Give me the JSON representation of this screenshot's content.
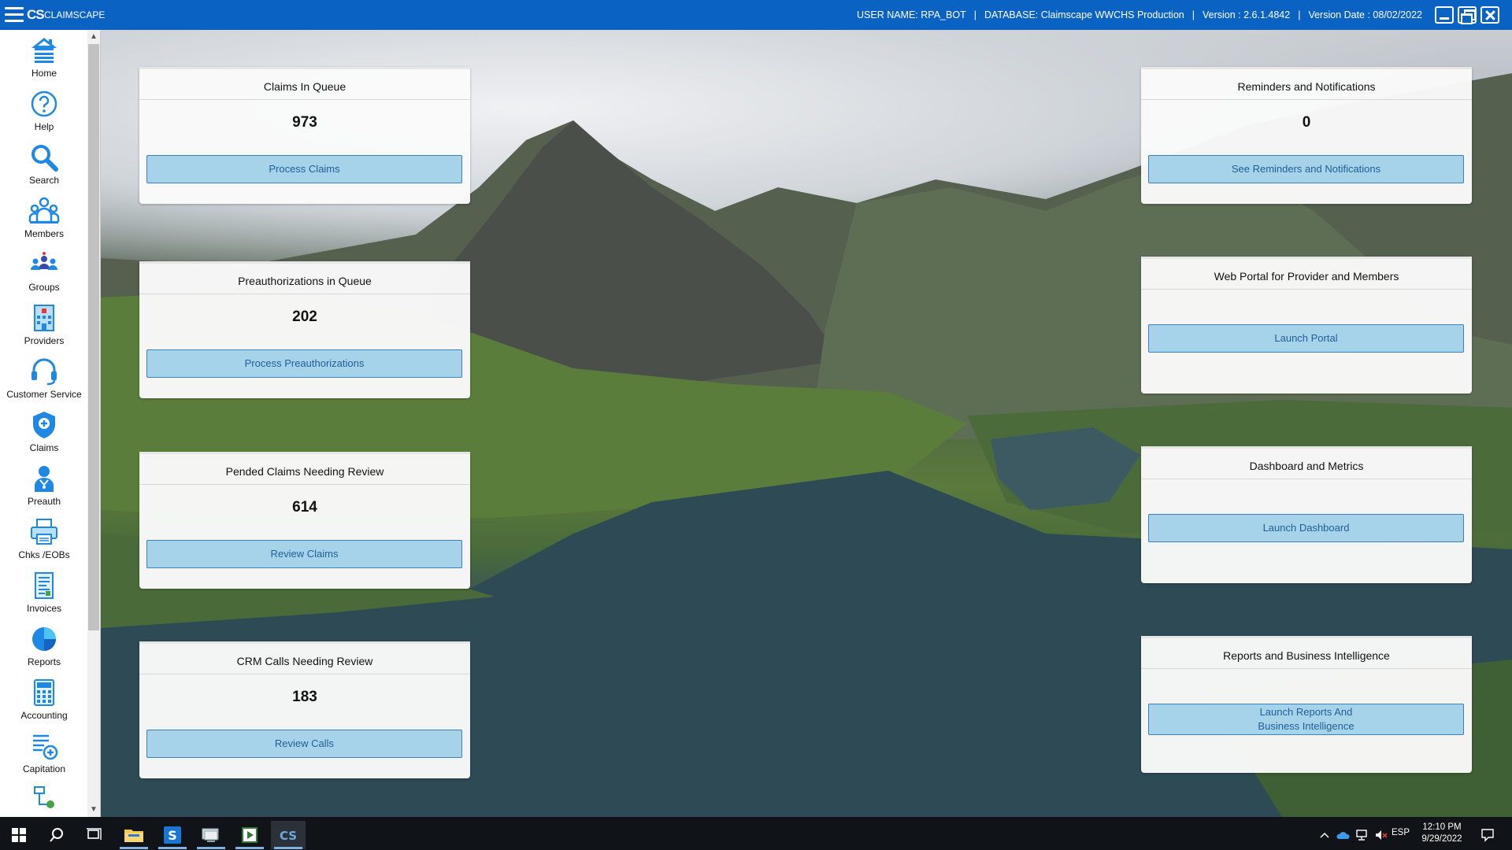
{
  "titlebar": {
    "app_name": "CLAIMSCAPE",
    "logo_text": "CS",
    "user": "USER NAME: RPA_BOT",
    "database": "DATABASE: Claimscape WWCHS Production",
    "version": "Version : 2.6.1.4842",
    "version_date": "Version Date : 08/02/2022",
    "separator": "|"
  },
  "sidebar": {
    "items": [
      {
        "label": "Home",
        "icon": "home-icon"
      },
      {
        "label": "Help",
        "icon": "help-icon"
      },
      {
        "label": "Search",
        "icon": "search-icon"
      },
      {
        "label": "Members",
        "icon": "members-icon"
      },
      {
        "label": "Groups",
        "icon": "groups-icon"
      },
      {
        "label": "Providers",
        "icon": "providers-icon"
      },
      {
        "label": "Customer Service",
        "icon": "headset-icon"
      },
      {
        "label": "Claims",
        "icon": "shield-plus-icon"
      },
      {
        "label": "Preauth",
        "icon": "doctor-icon"
      },
      {
        "label": "Chks /EOBs",
        "icon": "printer-icon"
      },
      {
        "label": "Invoices",
        "icon": "invoice-icon"
      },
      {
        "label": "Reports",
        "icon": "pie-chart-icon"
      },
      {
        "label": "Accounting",
        "icon": "calculator-icon"
      },
      {
        "label": "Capitation",
        "icon": "list-add-icon"
      }
    ]
  },
  "cards_left": [
    {
      "title": "Claims In Queue",
      "value": "973",
      "button": "Process Claims"
    },
    {
      "title": "Preauthorizations in Queue",
      "value": "202",
      "button": "Process Preauthorizations"
    },
    {
      "title": "Pended Claims Needing Review",
      "value": "614",
      "button": "Review Claims"
    },
    {
      "title": "CRM Calls Needing Review",
      "value": "183",
      "button": "Review Calls"
    }
  ],
  "cards_right": [
    {
      "title": "Reminders and Notifications",
      "value": "0",
      "button": "See Reminders and Notifications"
    },
    {
      "title": "Web Portal for Provider and Members",
      "value": "",
      "button": "Launch Portal"
    },
    {
      "title": "Dashboard and Metrics",
      "value": "",
      "button": "Launch Dashboard"
    },
    {
      "title": "Reports and Business Intelligence",
      "value": "",
      "button": "Launch Reports And\nBusiness Intelligence"
    }
  ],
  "taskbar": {
    "language": "ESP",
    "time": "12:10 PM",
    "date": "9/29/2022"
  },
  "colors": {
    "titlebar": "#0a63c2",
    "icon_blue": "#1e88e5",
    "button_fill": "#a7d3ea",
    "button_text": "#1f5f97"
  }
}
